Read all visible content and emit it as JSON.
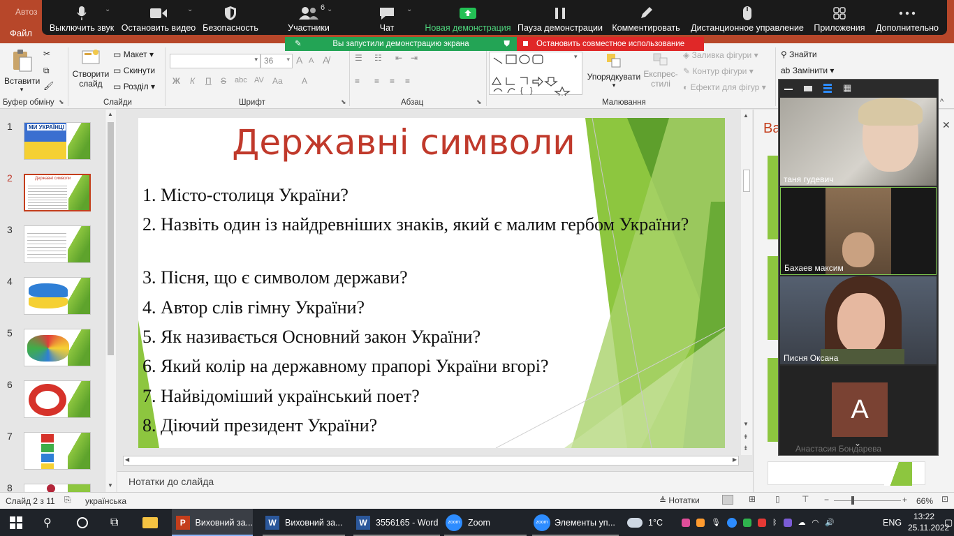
{
  "window": {
    "title_fragment": "Автоз",
    "file_tab": "Файл",
    "accent": "#b7472a"
  },
  "zoom_toolbar": {
    "mute": "Выключить звук",
    "stop_video": "Остановить видео",
    "security": "Безопасность",
    "participants": "Участники",
    "participants_count": "6",
    "chat": "Чат",
    "new_share": "Новая демонстрация",
    "pause_share": "Пауза демонстрации",
    "annotate": "Комментировать",
    "remote_control": "Дистанционное управление",
    "apps": "Приложения",
    "more": "Дополнительно"
  },
  "share_banner": {
    "message": "Вы запустили демонстрацию экрана",
    "stop": "Остановить совместное использование"
  },
  "ribbon": {
    "clipboard": {
      "paste": "Вставити",
      "label": "Буфер обміну"
    },
    "slides": {
      "new_slide_1": "Створити",
      "new_slide_2": "слайд",
      "layout": "Макет",
      "reset": "Скинути",
      "section": "Розділ",
      "label": "Слайди"
    },
    "font": {
      "font_name": "",
      "font_size": "36",
      "label": "Шрифт",
      "bold": "Ж",
      "italic": "К",
      "underline": "П",
      "strike": "S",
      "shadow": "abc",
      "spacing": "AV",
      "case": "Aa",
      "color": "A"
    },
    "paragraph": {
      "label": "Абзац"
    },
    "drawing": {
      "arrange": "Упорядкувати",
      "quick_styles_1": "Експрес-",
      "quick_styles_2": "стилі",
      "shape_fill": "Заливка фігури",
      "shape_outline": "Контур фігури",
      "shape_effects": "Ефекти для фігур",
      "label": "Малювання"
    },
    "editing": {
      "find": "Знайти",
      "replace": "Замінити"
    }
  },
  "thumbnails": [
    {
      "num": "1",
      "caption": "МИ УКРАЇНЦІ"
    },
    {
      "num": "2",
      "caption": "Державні символи"
    },
    {
      "num": "3",
      "caption": ""
    },
    {
      "num": "4",
      "caption": ""
    },
    {
      "num": "5",
      "caption": ""
    },
    {
      "num": "6",
      "caption": ""
    },
    {
      "num": "7",
      "caption": ""
    },
    {
      "num": "8",
      "caption": ""
    }
  ],
  "slide": {
    "title": "Державні символи",
    "questions": [
      "1. Місто-столиця України?",
      "2. Назвіть один із найдревніших знаків, який є малим гербом України?",
      "3. Пісня, що є символом держави?",
      "4. Автор слів гімну України?",
      "5. Як називається Основний закон України?",
      "6. Який колір на державному прапорі України вгорі?",
      "7. Найвідоміший український поет?",
      "8. Діючий президент України?"
    ],
    "accent": "#8dc63f"
  },
  "notes": {
    "placeholder": "Нотатки до слайда"
  },
  "right_pane": {
    "title_fragment": "Ва"
  },
  "zoom_panel": {
    "participants": [
      {
        "name": "таня гудевич"
      },
      {
        "name": "Бахаев максим"
      },
      {
        "name": "Писня Оксана"
      },
      {
        "name": "Анастасия Бондарева",
        "initial": "A"
      }
    ]
  },
  "statusbar": {
    "slide_info": "Слайд 2 з 11",
    "language": "українська",
    "notes": "Нотатки",
    "zoom": "66%"
  },
  "taskbar": {
    "apps": [
      {
        "label": "Виховний за..."
      },
      {
        "label": "Виховний за..."
      },
      {
        "label": "3556165 - Word"
      },
      {
        "label": "Zoom"
      },
      {
        "label": "Элементы уп..."
      }
    ],
    "weather": "1°C",
    "lang": "ENG",
    "time": "13:22",
    "date": "25.11.2022"
  }
}
